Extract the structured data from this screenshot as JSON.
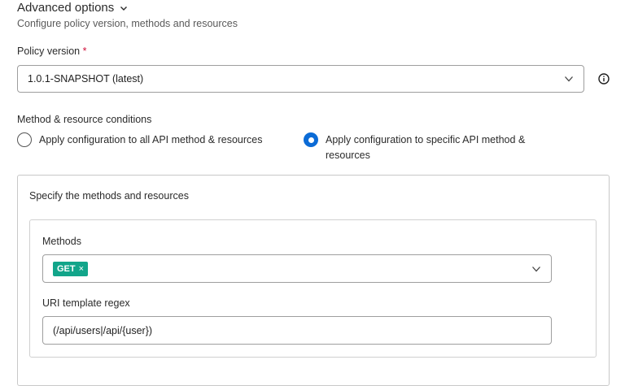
{
  "advanced": {
    "title": "Advanced options",
    "subtitle": "Configure policy version, methods and resources"
  },
  "policy_version": {
    "label": "Policy version",
    "required_marker": "*",
    "value": "1.0.1-SNAPSHOT (latest)"
  },
  "method_resource": {
    "label": "Method & resource conditions",
    "options": [
      {
        "label": "Apply configuration to all API method & resources",
        "selected": false
      },
      {
        "label": "Apply configuration to specific API method & resources",
        "selected": true
      }
    ]
  },
  "specify": {
    "title": "Specify the methods and resources",
    "methods_label": "Methods",
    "methods_selected": [
      "GET"
    ],
    "chip_remove": "×",
    "uri_label": "URI template regex",
    "uri_value": "(/api/users|/api/{user})"
  },
  "colors": {
    "accent": "#0b6bd6",
    "chip": "#12a58a",
    "required": "#d0103a"
  }
}
